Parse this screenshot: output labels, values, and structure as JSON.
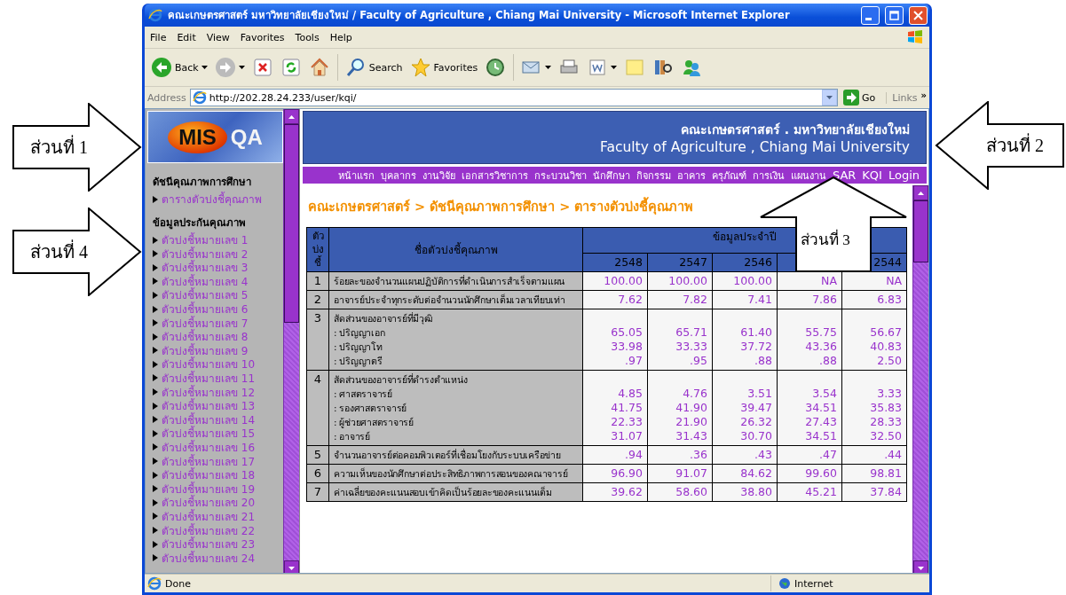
{
  "window": {
    "title": "คณะเกษตรศาสตร์ มหาวิทยาลัยเชียงใหม่ / Faculty of Agriculture , Chiang Mai University - Microsoft Internet Explorer"
  },
  "menu": [
    "File",
    "Edit",
    "View",
    "Favorites",
    "Tools",
    "Help"
  ],
  "toolbar": {
    "back": "Back",
    "search": "Search",
    "favorites": "Favorites"
  },
  "address_bar": {
    "label": "Address",
    "url": "http://202.28.24.233/user/kqi/",
    "go": "Go",
    "links": "Links",
    "more": "»"
  },
  "sidebar": {
    "logo": [
      "MIS",
      "QA"
    ],
    "sections": [
      {
        "heading": "ดัชนีคุณภาพการศึกษา",
        "items": [
          "ตารางตัวบ่งชี้คุณภาพ"
        ]
      },
      {
        "heading": "ข้อมูลประกันคุณภาพ",
        "items": [
          "ตัวบ่งชี้หมายเลข 1",
          "ตัวบ่งชี้หมายเลข 2",
          "ตัวบ่งชี้หมายเลข 3",
          "ตัวบ่งชี้หมายเลข 4",
          "ตัวบ่งชี้หมายเลข 5",
          "ตัวบ่งชี้หมายเลข 6",
          "ตัวบ่งชี้หมายเลข 7",
          "ตัวบ่งชี้หมายเลข 8",
          "ตัวบ่งชี้หมายเลข 9",
          "ตัวบ่งชี้หมายเลข 10",
          "ตัวบ่งชี้หมายเลข 11",
          "ตัวบ่งชี้หมายเลข 12",
          "ตัวบ่งชี้หมายเลข 13",
          "ตัวบ่งชี้หมายเลข 14",
          "ตัวบ่งชี้หมายเลข 15",
          "ตัวบ่งชี้หมายเลข 16",
          "ตัวบ่งชี้หมายเลข 17",
          "ตัวบ่งชี้หมายเลข 18",
          "ตัวบ่งชี้หมายเลข 19",
          "ตัวบ่งชี้หมายเลข 20",
          "ตัวบ่งชี้หมายเลข 21",
          "ตัวบ่งชี้หมายเลข 22",
          "ตัวบ่งชี้หมายเลข 23",
          "ตัวบ่งชี้หมายเลข 24"
        ]
      }
    ]
  },
  "banner": {
    "title_th": "คณะเกษตรศาสตร์ . มหาวิทยาลัยเชียงใหม่",
    "title_en": "Faculty of Agriculture , Chiang Mai University"
  },
  "nav": [
    "หน้าแรก",
    "บุคลากร",
    "งานวิจัย",
    "เอกสารวิชาการ",
    "กระบวนวิชา",
    "นักศึกษา",
    "กิจกรรม",
    "อาคาร",
    "ครุภัณฑ์",
    "การเงิน",
    "แผนงาน",
    "SAR",
    "KQI",
    "Login"
  ],
  "breadcrumb": "คณะเกษตรศาสตร์ > ดัชนีคุณภาพการศึกษา > ตารางตัวบ่งชี้คุณภาพ",
  "table": {
    "index_header": "ตัวบ่งชี้",
    "name_header": "ชื่อตัวบ่งชี้คุณภาพ",
    "group_header": "ข้อมูลประจำปี",
    "years": [
      "2548",
      "2547",
      "2546",
      "2544"
    ],
    "rows": [
      {
        "number": "1",
        "title": "ร้อยละของจำนวนแผนปฏิบัติการที่ดำเนินการสำเร็จตามแผน",
        "values": [
          "100.00",
          "100.00",
          "100.00",
          "NA",
          "NA"
        ]
      },
      {
        "number": "2",
        "title": "อาจารย์ประจำทุกระดับต่อจำนวนนักศึกษาเต็มเวลาเทียบเท่า",
        "values": [
          "7.62",
          "7.82",
          "7.41",
          "7.86",
          "6.83"
        ]
      },
      {
        "number": "3",
        "title": "สัดส่วนของอาจารย์ที่มีวุฒิ",
        "subrows": [
          {
            "label": ": ปริญญาเอก",
            "values": [
              "65.05",
              "65.71",
              "61.40",
              "55.75",
              "56.67"
            ]
          },
          {
            "label": ": ปริญญาโท",
            "values": [
              "33.98",
              "33.33",
              "37.72",
              "43.36",
              "40.83"
            ]
          },
          {
            "label": ": ปริญญาตรี",
            "values": [
              ".97",
              ".95",
              ".88",
              ".88",
              "2.50"
            ]
          }
        ]
      },
      {
        "number": "4",
        "title": "สัดส่วนของอาจารย์ที่ดำรงตำแหน่ง",
        "subrows": [
          {
            "label": ": ศาสตราจารย์",
            "values": [
              "4.85",
              "4.76",
              "3.51",
              "3.54",
              "3.33"
            ]
          },
          {
            "label": ": รองศาสตราจารย์",
            "values": [
              "41.75",
              "41.90",
              "39.47",
              "34.51",
              "35.83"
            ]
          },
          {
            "label": ": ผู้ช่วยศาสตราจารย์",
            "values": [
              "22.33",
              "21.90",
              "26.32",
              "27.43",
              "28.33"
            ]
          },
          {
            "label": ": อาจารย์",
            "values": [
              "31.07",
              "31.43",
              "30.70",
              "34.51",
              "32.50"
            ]
          }
        ]
      },
      {
        "number": "5",
        "title": "จำนวนอาจารย์ต่อคอมพิวเตอร์ที่เชื่อมโยงกับระบบเครือข่าย",
        "values": [
          ".94",
          ".36",
          ".43",
          ".47",
          ".44"
        ]
      },
      {
        "number": "6",
        "title": "ความเห็นของนักศึกษาต่อประสิทธิภาพการสอนของคณาจารย์",
        "values": [
          "96.90",
          "91.07",
          "84.62",
          "99.60",
          "98.81"
        ]
      },
      {
        "number": "7",
        "title": "ค่าเฉลี่ยของคะแนนสอบเข้าคิดเป็นร้อยละของคะแนนเต็ม",
        "values": [
          "39.62",
          "58.60",
          "38.80",
          "45.21",
          "37.84"
        ]
      }
    ]
  },
  "status_bar": {
    "text": "Done",
    "zone": "Internet"
  },
  "callouts": [
    {
      "label": "ส่วนที่ 1",
      "kind": "right"
    },
    {
      "label": "ส่วนที่ 2",
      "kind": "left"
    },
    {
      "label": "ส่วนที่ 3",
      "kind": "up"
    },
    {
      "label": "ส่วนที่ 4",
      "kind": "right"
    }
  ]
}
